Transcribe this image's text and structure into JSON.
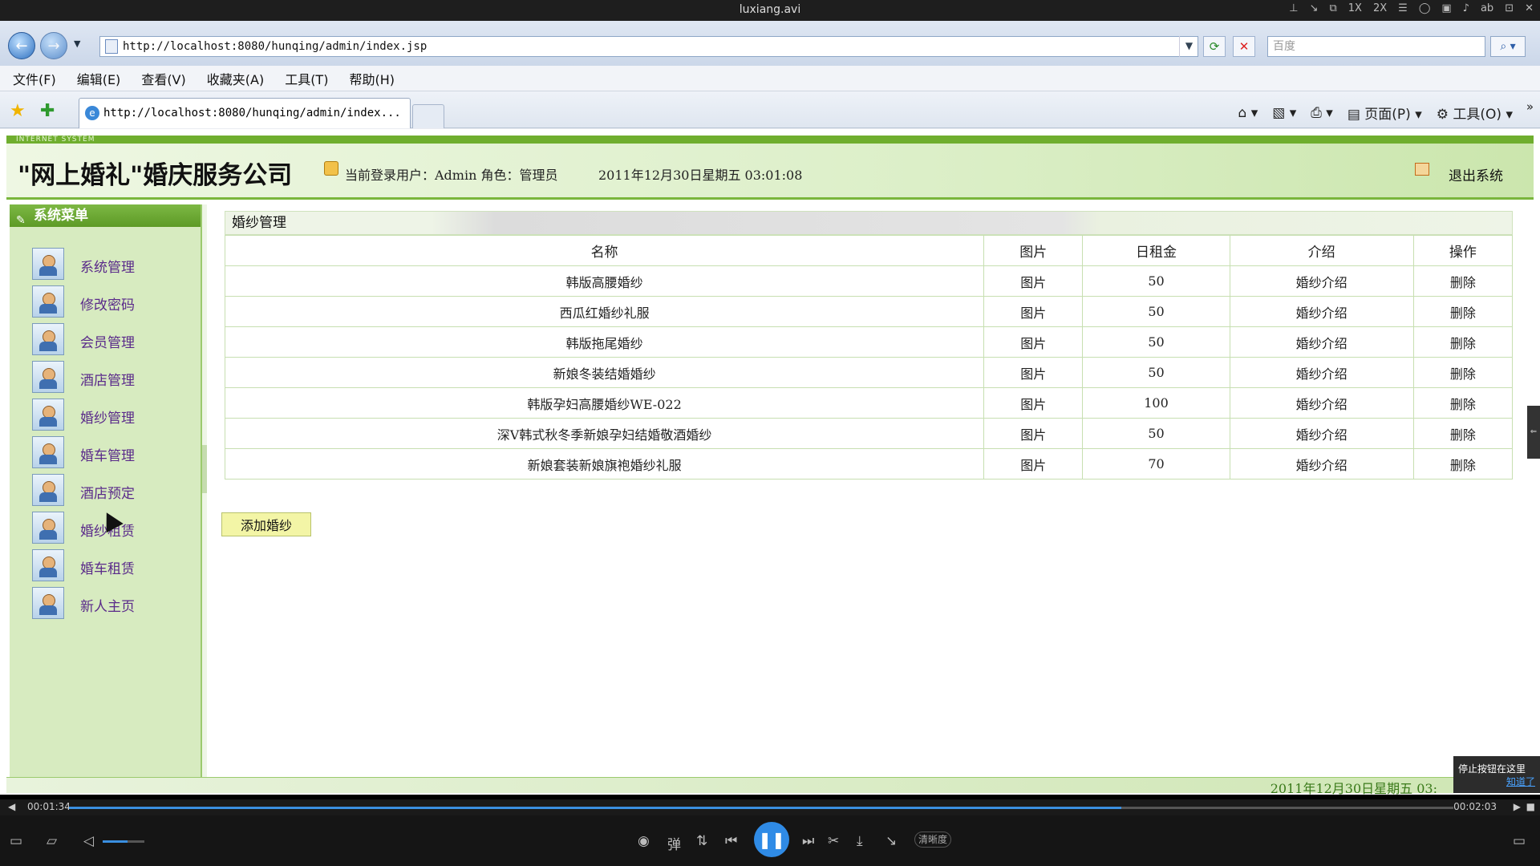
{
  "player": {
    "title": "luxiang.avi",
    "title_controls": [
      "1X",
      "2X"
    ],
    "elapsed": "00:01:34",
    "total": "00:02:03",
    "progress": 0.76,
    "volume": 0.6,
    "danmu_label": "弹",
    "quality_label": "清晰度",
    "tooltip": {
      "text": "停止按钮在这里",
      "link": "知道了"
    }
  },
  "browser": {
    "url": "http://localhost:8080/hunqing/admin/index.jsp",
    "search_placeholder": "百度",
    "menu": [
      "文件(F)",
      "编辑(E)",
      "查看(V)",
      "收藏夹(A)",
      "工具(T)",
      "帮助(H)"
    ],
    "tab_title": "http://localhost:8080/hunqing/admin/index...",
    "cmd_page": "页面(P)",
    "cmd_tools": "工具(O)"
  },
  "site": {
    "strip_text": "INTERNET SYSTEM",
    "title": "\"网上婚礼\"婚庆服务公司",
    "login_info": "当前登录用户：Admin 角色：管理员",
    "date_time": "2011年12月30日星期五  03:01:08",
    "logout": "退出系统",
    "footer_date": "2011年12月30日星期五  03:"
  },
  "sidebar": {
    "title": "系统菜单",
    "items": [
      {
        "label": "系统管理"
      },
      {
        "label": "修改密码"
      },
      {
        "label": "会员管理"
      },
      {
        "label": "酒店管理"
      },
      {
        "label": "婚纱管理"
      },
      {
        "label": "婚车管理"
      },
      {
        "label": "酒店预定"
      },
      {
        "label": "婚纱租赁"
      },
      {
        "label": "婚车租赁"
      },
      {
        "label": "新人主页"
      }
    ]
  },
  "panel": {
    "title": "婚纱管理",
    "columns": [
      "名称",
      "图片",
      "日租金",
      "介绍",
      "操作"
    ],
    "rows": [
      [
        "韩版高腰婚纱",
        "图片",
        "50",
        "婚纱介绍",
        "删除"
      ],
      [
        "西瓜红婚纱礼服",
        "图片",
        "50",
        "婚纱介绍",
        "删除"
      ],
      [
        "韩版拖尾婚纱",
        "图片",
        "50",
        "婚纱介绍",
        "删除"
      ],
      [
        "新娘冬装结婚婚纱",
        "图片",
        "50",
        "婚纱介绍",
        "删除"
      ],
      [
        "韩版孕妇高腰婚纱WE-022",
        "图片",
        "100",
        "婚纱介绍",
        "删除"
      ],
      [
        "深V韩式秋冬季新娘孕妇结婚敬酒婚纱",
        "图片",
        "50",
        "婚纱介绍",
        "删除"
      ],
      [
        "新娘套装新娘旗袍婚纱礼服",
        "图片",
        "70",
        "婚纱介绍",
        "删除"
      ]
    ],
    "add_button": "添加婚纱"
  }
}
